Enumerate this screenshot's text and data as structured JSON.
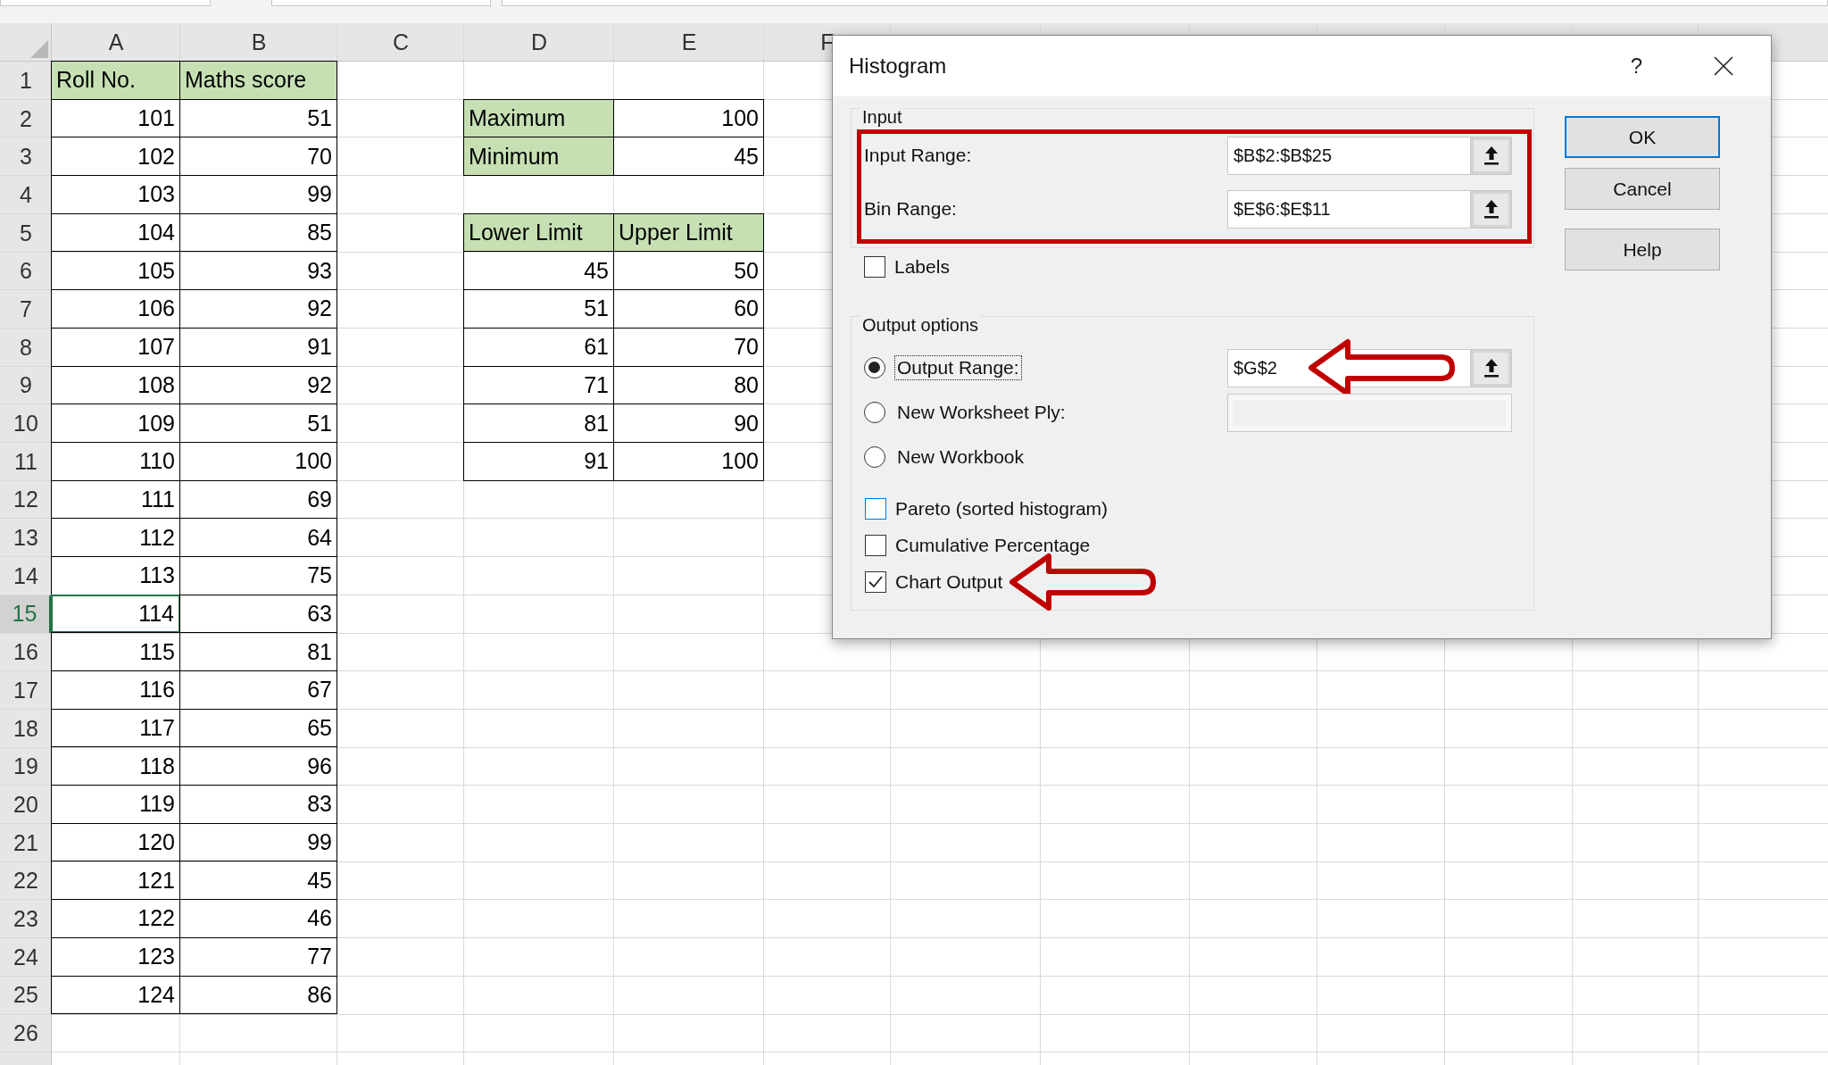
{
  "sheet": {
    "columns": [
      {
        "label": "A"
      },
      {
        "label": "B"
      },
      {
        "label": "C"
      },
      {
        "label": "D"
      },
      {
        "label": "E"
      },
      {
        "label": "F"
      }
    ],
    "rows": [
      {
        "label": "1",
        "selected": false,
        "cells": [
          {
            "text": "Roll No.",
            "kind": "header"
          },
          {
            "text": "Maths score",
            "kind": "header"
          }
        ]
      },
      {
        "label": "2",
        "selected": false,
        "cells": [
          {
            "text": "101",
            "kind": "number"
          },
          {
            "text": "51",
            "kind": "number"
          },
          null,
          {
            "text": "Maximum",
            "kind": "header"
          },
          {
            "text": "100",
            "kind": "number"
          }
        ]
      },
      {
        "label": "3",
        "selected": false,
        "cells": [
          {
            "text": "102",
            "kind": "number"
          },
          {
            "text": "70",
            "kind": "number"
          },
          null,
          {
            "text": "Minimum",
            "kind": "header"
          },
          {
            "text": "45",
            "kind": "number"
          }
        ]
      },
      {
        "label": "4",
        "selected": false,
        "cells": [
          {
            "text": "103",
            "kind": "number"
          },
          {
            "text": "99",
            "kind": "number"
          }
        ]
      },
      {
        "label": "5",
        "selected": false,
        "cells": [
          {
            "text": "104",
            "kind": "number"
          },
          {
            "text": "85",
            "kind": "number"
          },
          null,
          {
            "text": "Lower Limit",
            "kind": "header"
          },
          {
            "text": "Upper Limit",
            "kind": "header"
          }
        ]
      },
      {
        "label": "6",
        "selected": false,
        "cells": [
          {
            "text": "105",
            "kind": "number"
          },
          {
            "text": "93",
            "kind": "number"
          },
          null,
          {
            "text": "45",
            "kind": "number"
          },
          {
            "text": "50",
            "kind": "number"
          }
        ]
      },
      {
        "label": "7",
        "selected": false,
        "cells": [
          {
            "text": "106",
            "kind": "number"
          },
          {
            "text": "92",
            "kind": "number"
          },
          null,
          {
            "text": "51",
            "kind": "number"
          },
          {
            "text": "60",
            "kind": "number"
          }
        ]
      },
      {
        "label": "8",
        "selected": false,
        "cells": [
          {
            "text": "107",
            "kind": "number"
          },
          {
            "text": "91",
            "kind": "number"
          },
          null,
          {
            "text": "61",
            "kind": "number"
          },
          {
            "text": "70",
            "kind": "number"
          }
        ]
      },
      {
        "label": "9",
        "selected": false,
        "cells": [
          {
            "text": "108",
            "kind": "number"
          },
          {
            "text": "92",
            "kind": "number"
          },
          null,
          {
            "text": "71",
            "kind": "number"
          },
          {
            "text": "80",
            "kind": "number"
          }
        ]
      },
      {
        "label": "10",
        "selected": false,
        "cells": [
          {
            "text": "109",
            "kind": "number"
          },
          {
            "text": "51",
            "kind": "number"
          },
          null,
          {
            "text": "81",
            "kind": "number"
          },
          {
            "text": "90",
            "kind": "number"
          }
        ]
      },
      {
        "label": "11",
        "selected": false,
        "cells": [
          {
            "text": "110",
            "kind": "number"
          },
          {
            "text": "100",
            "kind": "number"
          },
          null,
          {
            "text": "91",
            "kind": "number"
          },
          {
            "text": "100",
            "kind": "number"
          }
        ]
      },
      {
        "label": "12",
        "selected": false,
        "cells": [
          {
            "text": "111",
            "kind": "number"
          },
          {
            "text": "69",
            "kind": "number"
          }
        ]
      },
      {
        "label": "13",
        "selected": false,
        "cells": [
          {
            "text": "112",
            "kind": "number"
          },
          {
            "text": "64",
            "kind": "number"
          }
        ]
      },
      {
        "label": "14",
        "selected": false,
        "cells": [
          {
            "text": "113",
            "kind": "number"
          },
          {
            "text": "75",
            "kind": "number"
          }
        ]
      },
      {
        "label": "15",
        "selected": true,
        "cells": [
          {
            "text": "114",
            "kind": "number"
          },
          {
            "text": "63",
            "kind": "number"
          }
        ]
      },
      {
        "label": "16",
        "selected": false,
        "cells": [
          {
            "text": "115",
            "kind": "number"
          },
          {
            "text": "81",
            "kind": "number"
          }
        ]
      },
      {
        "label": "17",
        "selected": false,
        "cells": [
          {
            "text": "116",
            "kind": "number"
          },
          {
            "text": "67",
            "kind": "number"
          }
        ]
      },
      {
        "label": "18",
        "selected": false,
        "cells": [
          {
            "text": "117",
            "kind": "number"
          },
          {
            "text": "65",
            "kind": "number"
          }
        ]
      },
      {
        "label": "19",
        "selected": false,
        "cells": [
          {
            "text": "118",
            "kind": "number"
          },
          {
            "text": "96",
            "kind": "number"
          }
        ]
      },
      {
        "label": "20",
        "selected": false,
        "cells": [
          {
            "text": "119",
            "kind": "number"
          },
          {
            "text": "83",
            "kind": "number"
          }
        ]
      },
      {
        "label": "21",
        "selected": false,
        "cells": [
          {
            "text": "120",
            "kind": "number"
          },
          {
            "text": "99",
            "kind": "number"
          }
        ]
      },
      {
        "label": "22",
        "selected": false,
        "cells": [
          {
            "text": "121",
            "kind": "number"
          },
          {
            "text": "45",
            "kind": "number"
          }
        ]
      },
      {
        "label": "23",
        "selected": false,
        "cells": [
          {
            "text": "122",
            "kind": "number"
          },
          {
            "text": "46",
            "kind": "number"
          }
        ]
      },
      {
        "label": "24",
        "selected": false,
        "cells": [
          {
            "text": "123",
            "kind": "number"
          },
          {
            "text": "77",
            "kind": "number"
          }
        ]
      },
      {
        "label": "25",
        "selected": false,
        "cells": [
          {
            "text": "124",
            "kind": "number"
          },
          {
            "text": "86",
            "kind": "number"
          }
        ]
      },
      {
        "label": "26",
        "selected": false
      }
    ]
  },
  "dialog": {
    "title": "Histogram",
    "help": "?",
    "input": {
      "legend": "Input",
      "highlighted": true,
      "fields": [
        {
          "label": "Input Range:",
          "value": "$B$2:$B$25"
        },
        {
          "label": "Bin Range:",
          "value": "$E$6:$E$11"
        }
      ]
    },
    "labels_checkbox": {
      "label": "Labels",
      "checked": false,
      "hover": false,
      "arrow": false
    },
    "output": {
      "legend": "Output options",
      "options": [
        {
          "label": "Output Range:",
          "selected": true,
          "focused": true,
          "field": {
            "value": "$G$2",
            "disabled": false,
            "arrow": true
          }
        },
        {
          "label": "New Worksheet Ply:",
          "selected": false,
          "focused": false,
          "field": {
            "disabled": true,
            "arrow": false
          }
        },
        {
          "label": "New Workbook",
          "selected": false,
          "focused": false
        }
      ],
      "checkboxes": [
        {
          "label": "Pareto (sorted histogram)",
          "checked": false,
          "hover": true,
          "arrow": false
        },
        {
          "label": "Cumulative Percentage",
          "checked": false,
          "hover": false,
          "arrow": false
        },
        {
          "label": "Chart Output",
          "checked": true,
          "hover": false,
          "arrow": true
        }
      ]
    },
    "buttons": [
      {
        "label": "OK",
        "default": true
      },
      {
        "label": "Cancel",
        "default": false
      },
      {
        "label": "Help",
        "default": false
      }
    ]
  }
}
